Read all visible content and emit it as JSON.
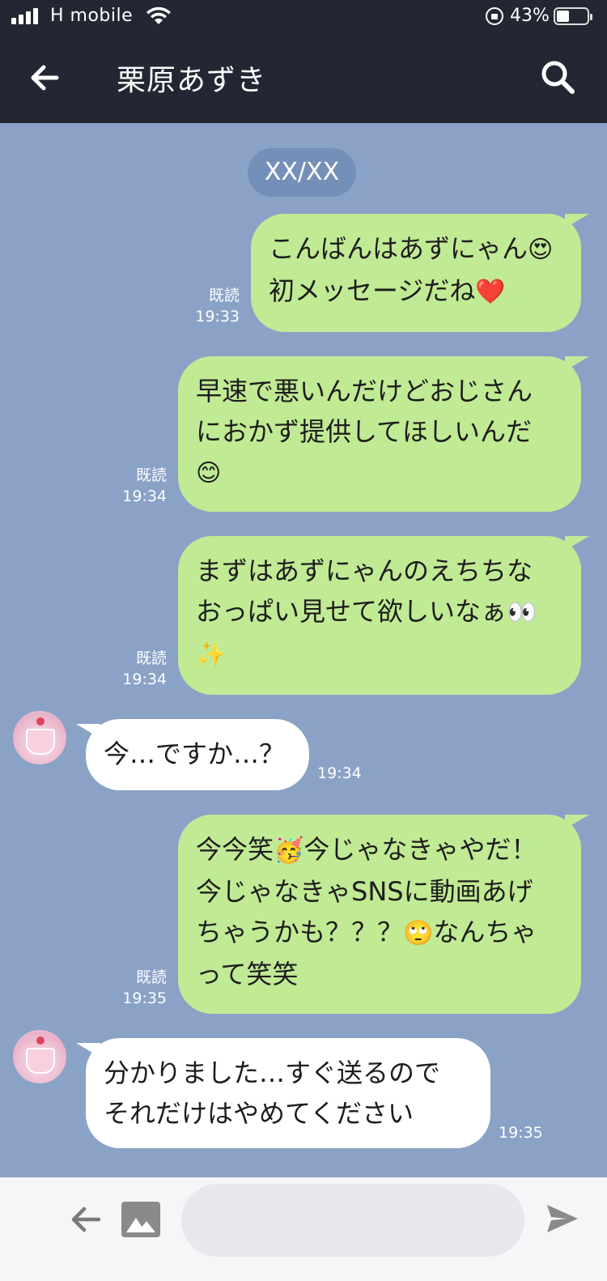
{
  "status_bar": {
    "carrier": "H mobile",
    "battery_percent": "43%"
  },
  "header": {
    "title": "栗原あずき",
    "back_icon": "arrow-left-icon",
    "search_icon": "search-icon"
  },
  "date_label": "XX/XX",
  "messages": [
    {
      "direction": "sent",
      "lines": [
        "こんばんはあずにゃん",
        "初メッセージだね"
      ],
      "emojis": [
        "😍",
        "❤️"
      ],
      "read": "既読",
      "time": "19:33"
    },
    {
      "direction": "sent",
      "lines": [
        "早速で悪いんだけどおじさん",
        "におかず提供してほしいんだ"
      ],
      "emojis": [
        "😊"
      ],
      "read": "既読",
      "time": "19:34"
    },
    {
      "direction": "sent",
      "lines": [
        "まずはあずにゃんのえちちな",
        "おっぱい見せて欲しいなぁ"
      ],
      "emojis": [
        "👀",
        "✨"
      ],
      "read": "既読",
      "time": "19:34"
    },
    {
      "direction": "received",
      "lines": [
        "今…ですか…？"
      ],
      "time": "19:34"
    },
    {
      "direction": "sent",
      "lines": [
        "今今笑",
        "今じゃなきゃやだ！",
        "今じゃなきゃSNSに動画あげ",
        "ちゃうかも？？？",
        "なんちゃ",
        "って笑笑"
      ],
      "emojis": [
        "🥳",
        "🙄"
      ],
      "read": "既読",
      "time": "19:35"
    },
    {
      "direction": "received",
      "lines": [
        "分かりました…すぐ送るので",
        "それだけはやめてください"
      ],
      "time": "19:35"
    }
  ],
  "input": {
    "placeholder": ""
  },
  "colors": {
    "header_bg": "#232733",
    "chat_bg": "#8aa2c6",
    "sent_bubble": "#c1ea94",
    "received_bubble": "#ffffff"
  }
}
